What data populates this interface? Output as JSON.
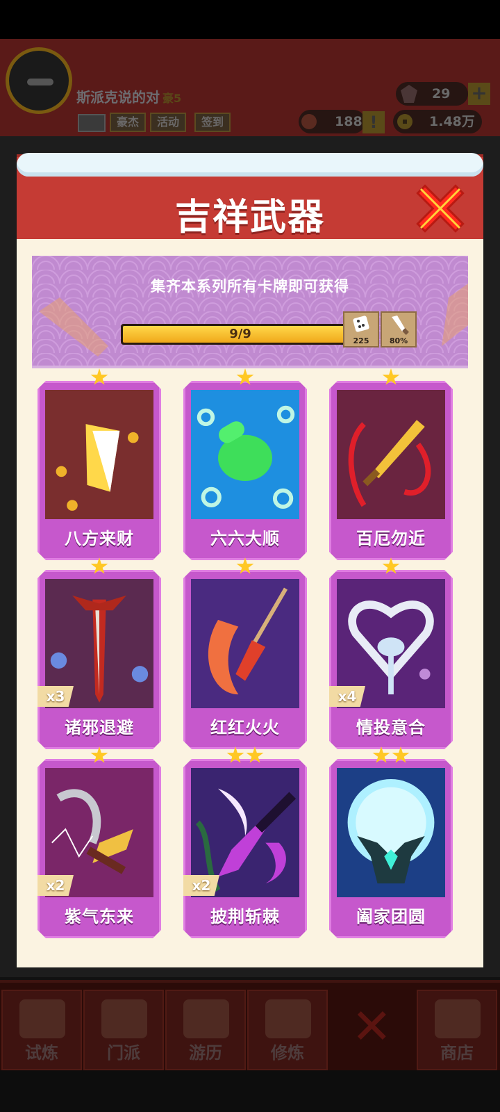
{
  "topbar": {
    "player_name": "斯派克说的对",
    "player_level": "豪5",
    "tags": [
      "豪杰",
      "活动",
      "签到"
    ],
    "gems": "29",
    "plus": "+",
    "coins_a": "1884",
    "alert": "!",
    "coins_b": "1.48万"
  },
  "modal": {
    "title": "吉祥武器",
    "banner_text": "集齐本系列所有卡牌即可获得",
    "progress_text": "9/9",
    "progress": 1.0,
    "rewards": [
      {
        "icon": "dice-icon",
        "value": "225"
      },
      {
        "icon": "knife-icon",
        "value": "80%"
      }
    ]
  },
  "cards": [
    {
      "name": "八方来财",
      "stars": 1,
      "count": "",
      "bg": "#7a2e2e",
      "icon": "gold-axe-icon"
    },
    {
      "name": "六六大顺",
      "stars": 1,
      "count": "",
      "bg": "#1e8fe0",
      "icon": "green-hand-icon"
    },
    {
      "name": "百厄勿近",
      "stars": 1,
      "count": "",
      "bg": "#6a2440",
      "icon": "golden-sword-icon"
    },
    {
      "name": "诸邪退避",
      "stars": 1,
      "count": "x3",
      "bg": "#5b2a50",
      "icon": "red-sword-icon"
    },
    {
      "name": "红红火火",
      "stars": 1,
      "count": "",
      "bg": "#4a2a80",
      "icon": "fire-spear-icon"
    },
    {
      "name": "情投意合",
      "stars": 1,
      "count": "x4",
      "bg": "#5a2478",
      "icon": "heart-scepter-icon"
    },
    {
      "name": "紫气东来",
      "stars": 1,
      "count": "x2",
      "bg": "#7a2668",
      "icon": "lightning-scythe-icon"
    },
    {
      "name": "披荆斩棘",
      "stars": 2,
      "count": "x2",
      "bg": "#3a2470",
      "icon": "moon-spear-icon"
    },
    {
      "name": "阖家团圆",
      "stars": 2,
      "count": "",
      "bg": "#1c3f86",
      "icon": "moon-antler-icon"
    }
  ],
  "bottom_nav": [
    "试炼",
    "门派",
    "游历",
    "修炼",
    "",
    "商店"
  ]
}
